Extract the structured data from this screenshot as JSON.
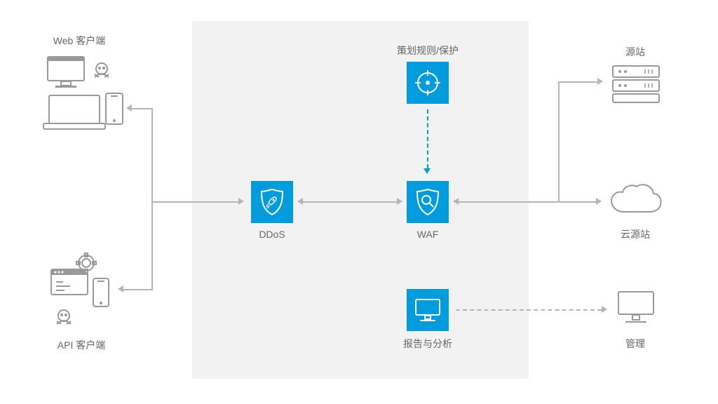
{
  "labels": {
    "web_client": "Web 客户端",
    "api_client": "API 客户端",
    "ddos": "DDoS",
    "waf": "WAF",
    "policy": "策划规则/保护",
    "report": "报告与分析",
    "origin": "源站",
    "cloud_origin": "云源站",
    "management": "管理"
  },
  "colors": {
    "accent": "#009cde",
    "panel_bg": "#f2f2f2",
    "line": "#b5b5b5",
    "icon_gray": "#999999"
  },
  "diagram": {
    "left_group": [
      "web_client",
      "api_client"
    ],
    "center_nodes": [
      "ddos",
      "waf",
      "policy",
      "report"
    ],
    "right_group": [
      "origin",
      "cloud_origin",
      "management"
    ],
    "edges_solid_bidir": [
      [
        "web_client_group",
        "ddos"
      ],
      [
        "ddos",
        "waf"
      ],
      [
        "waf",
        "right_split"
      ],
      [
        "right_split",
        "origin"
      ],
      [
        "right_split",
        "cloud_origin"
      ]
    ],
    "edges_dashed": [
      [
        "policy",
        "waf"
      ],
      [
        "report",
        "management"
      ]
    ]
  }
}
